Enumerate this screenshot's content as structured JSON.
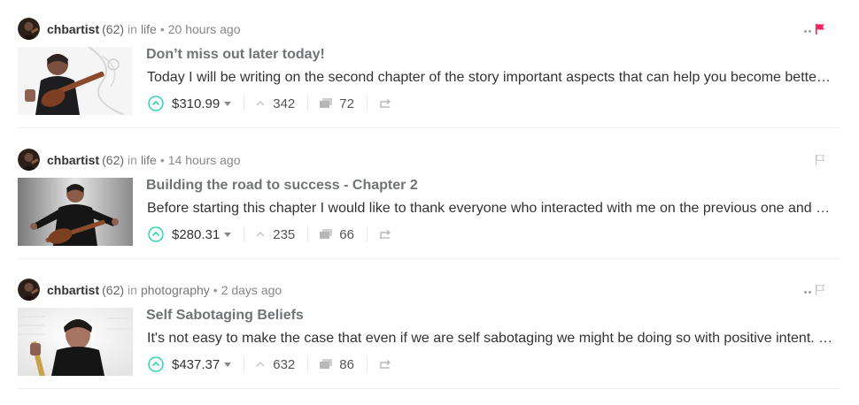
{
  "posts": [
    {
      "author": "chbartist",
      "reputation": "(62)",
      "in_word": "in",
      "category": "life",
      "bullet": "•",
      "time_ago": "20 hours ago",
      "title": "Don’t miss out later today!",
      "summary": "Today I will be writing on the second chapter of the story important aspects that can help you become better…",
      "payout": "$310.99",
      "votes": "342",
      "comments": "72",
      "flag_state": "flagged",
      "flag_color": "#f4245b",
      "show_dots": true
    },
    {
      "author": "chbartist",
      "reputation": "(62)",
      "in_word": "in",
      "category": "life",
      "bullet": "•",
      "time_ago": "14 hours ago",
      "title": "Building the road to success - Chapter 2",
      "summary": "Before starting this chapter I would like to thank everyone who interacted with me on the previous one and …",
      "payout": "$280.31",
      "votes": "235",
      "comments": "66",
      "flag_state": "outline",
      "flag_color": "#c8c8c8",
      "show_dots": false
    },
    {
      "author": "chbartist",
      "reputation": "(62)",
      "in_word": "in",
      "category": "photography",
      "bullet": "•",
      "time_ago": "2 days ago",
      "title": "Self Sabotaging Beliefs",
      "summary": "It's not easy to make the case that even if we are self sabotaging we might be doing so with positive intent. …",
      "payout": "$437.37",
      "votes": "632",
      "comments": "86",
      "flag_state": "outline",
      "flag_color": "#c8c8c8",
      "show_dots": true
    }
  ],
  "colors": {
    "upvote_green": "#06d6a9",
    "icon_gray": "#b8b8b8",
    "flag_active": "#f4245b"
  },
  "icons": {
    "upvote": "upvote-circle-icon",
    "votes": "chevron-up-icon",
    "comments": "comments-icon",
    "reblog": "reblog-icon",
    "flag": "flag-icon",
    "more": "dots-icon"
  }
}
